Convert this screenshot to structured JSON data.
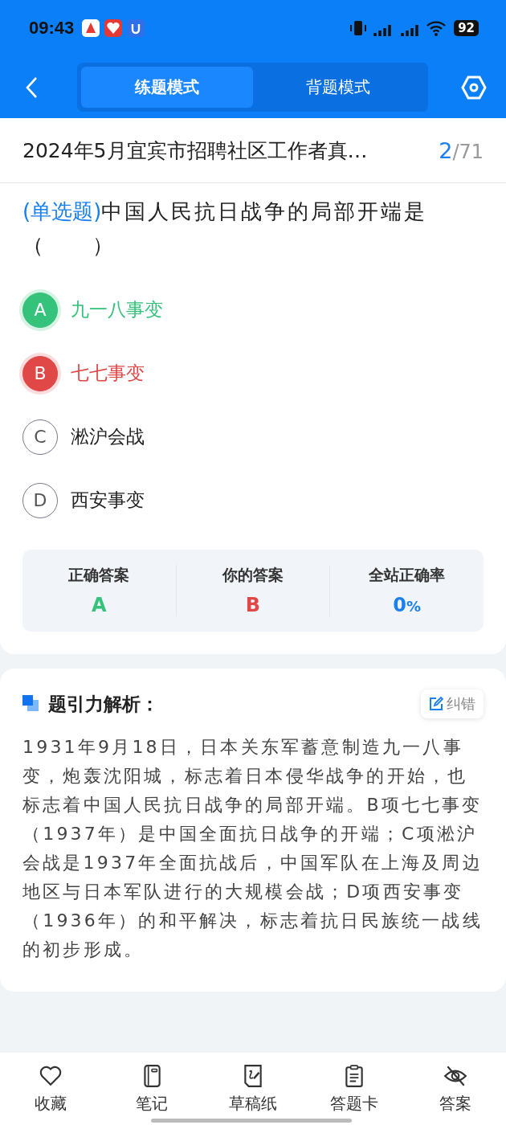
{
  "status_bar": {
    "time": "09:43",
    "battery": "92"
  },
  "header": {
    "tabs": [
      {
        "label": "练题模式",
        "selected": true
      },
      {
        "label": "背题模式",
        "selected": false
      }
    ]
  },
  "paper": {
    "title": "2024年5月宜宾市招聘社区工作者真…",
    "current": "2",
    "total": "/71"
  },
  "question": {
    "type": "(单选题)",
    "stem": "中国人民抗日战争的局部开端是（　　）"
  },
  "options": [
    {
      "letter": "A",
      "text": "九一八事变",
      "kind": "correct"
    },
    {
      "letter": "B",
      "text": "七七事变",
      "kind": "wrong"
    },
    {
      "letter": "C",
      "text": "淞沪会战",
      "kind": "plain"
    },
    {
      "letter": "D",
      "text": "西安事变",
      "kind": "plain"
    }
  ],
  "summary": [
    {
      "label": "正确答案",
      "value": "A",
      "kind": "correct"
    },
    {
      "label": "你的答案",
      "value": "B",
      "kind": "wrong"
    },
    {
      "label": "全站正确率",
      "value": "0",
      "unit": "%",
      "kind": "rate"
    }
  ],
  "analysis": {
    "title": "题引力解析：",
    "report": "纠错",
    "text": "1931年9月18日，日本关东军蓄意制造九一八事变，炮轰沈阳城，标志着日本侵华战争的开始，也标志着中国人民抗日战争的局部开端。B项七七事变（1937年）是中国全面抗日战争的开端；C项淞沪会战是1937年全面抗战后，中国军队在上海及周边地区与日本军队进行的大规模会战；D项西安事变（1936年）的和平解决，标志着抗日民族统一战线的初步形成。"
  },
  "bottom_bar": [
    {
      "label": "收藏",
      "kind": "heart"
    },
    {
      "label": "笔记",
      "kind": "notebook"
    },
    {
      "label": "草稿纸",
      "kind": "draft"
    },
    {
      "label": "答题卡",
      "kind": "card"
    },
    {
      "label": "答案",
      "kind": "eye"
    }
  ]
}
